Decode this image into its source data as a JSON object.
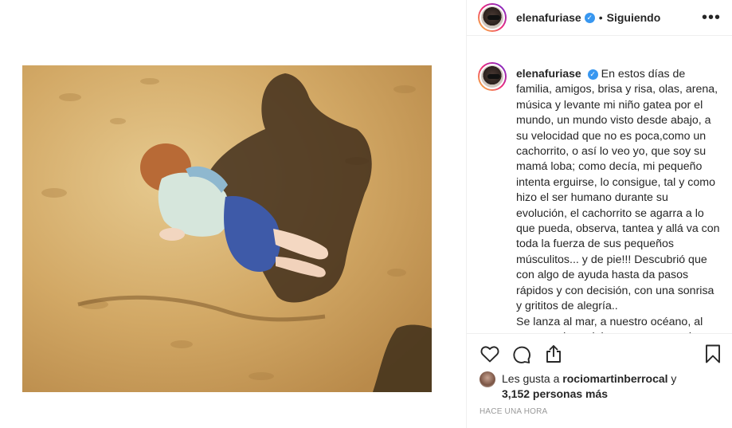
{
  "post": {
    "username": "elenafuriase",
    "separator": "•",
    "follow_status": "Siguiendo",
    "more_label": "•••",
    "caption": "En estos días de familia, amigos, brisa y risa, olas, arena, música y levante mi niño gatea por el mundo, un mundo visto desde abajo, a su velocidad que no es poca,como un cachorrito, o así lo veo yo, que soy su mamá loba; como decía, mi pequeño intenta erguirse, lo consigue, tal y como hizo el ser humano durante su evolución, el cachorrito se agarra a lo que pueda, observa, tantea y allá va con toda la fuerza de sus pequeños músculitos... y de pie!!! Descubrió que con algo de ayuda hasta da pasos rápidos y con decisión, con una sonrisa y grititos de alegría..",
    "caption_continued": "Se lanza al mar, a nuestro océano, al que por cierto debemos proteger sin",
    "likes_prefix": "Les gusta a ",
    "likes_user": "rociomartinberrocal",
    "likes_suffix": " y",
    "likes_count": "3,152 personas más",
    "timestamp": "HACE UNA HORA"
  },
  "icons": {
    "verified": "verified-badge-icon",
    "like": "heart-icon",
    "comment": "comment-bubble-icon",
    "share": "share-icon",
    "save": "bookmark-icon",
    "more": "more-options-icon"
  },
  "colors": {
    "verified_blue": "#3897f0",
    "text": "#262626",
    "muted": "#999999",
    "border": "#efefef"
  }
}
